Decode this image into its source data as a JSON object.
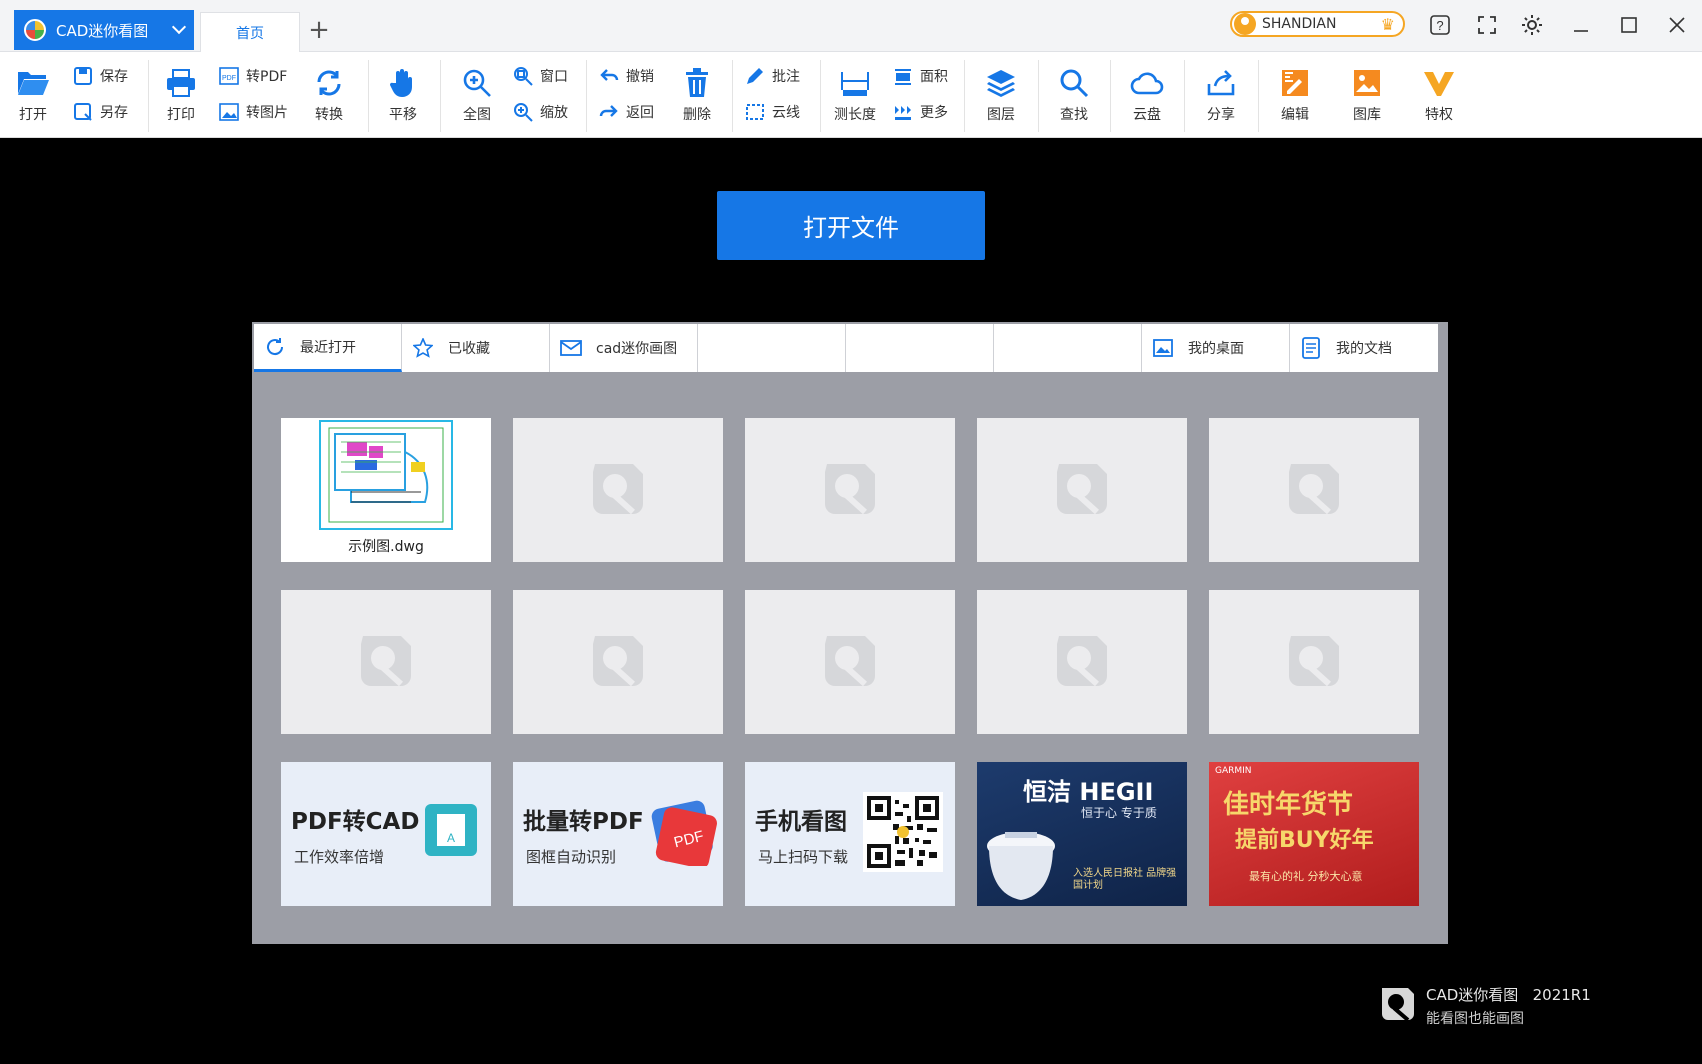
{
  "titlebar": {
    "app_name": "CAD迷你看图",
    "tab_home": "首页",
    "tab_add": "+",
    "user_name": "SHANDIAN"
  },
  "ribbon": {
    "open": "打开",
    "save": "保存",
    "save_as": "另存",
    "print": "打印",
    "to_pdf": "转PDF",
    "to_image": "转图片",
    "convert": "转换",
    "pan": "平移",
    "full_view": "全图",
    "window": "窗口",
    "zoom": "缩放",
    "undo": "撤销",
    "back": "返回",
    "delete": "删除",
    "annotate": "批注",
    "cloud_line": "云线",
    "measure_length": "测长度",
    "area": "面积",
    "more": "更多",
    "layers": "图层",
    "find": "查找",
    "cloud_disk": "云盘",
    "share": "分享",
    "edit": "编辑",
    "gallery": "图库",
    "privilege": "特权"
  },
  "main": {
    "open_file_button": "打开文件",
    "tabs": [
      {
        "label": "最近打开"
      },
      {
        "label": "已收藏"
      },
      {
        "label": "cad迷你画图"
      },
      {
        "label": ""
      },
      {
        "label": ""
      },
      {
        "label": ""
      },
      {
        "label": "我的桌面"
      },
      {
        "label": "我的文档"
      }
    ],
    "recent_file": "示例图.dwg",
    "promos": [
      {
        "title": "PDF转CAD",
        "subtitle": "工作效率倍增"
      },
      {
        "title": "批量转PDF",
        "subtitle": "图框自动识别"
      },
      {
        "title": "手机看图",
        "subtitle": "马上扫码下载"
      }
    ],
    "ads": [
      {
        "title": "恒洁 HEGII",
        "subtitle": "恒于心 专于质",
        "note": "入选人民日报社 品牌强国计划"
      },
      {
        "title": "佳时年货节",
        "subtitle": "提前BUY好年",
        "note": "最有心的礼 分秒大心意",
        "brand": "GARMIN"
      }
    ]
  },
  "footer": {
    "product": "CAD迷你看图",
    "version": "2021R1",
    "slogan": "能看图也能画图"
  },
  "colors": {
    "accent": "#1677e6",
    "panel": "#9c9ea6",
    "background": "#000000"
  }
}
